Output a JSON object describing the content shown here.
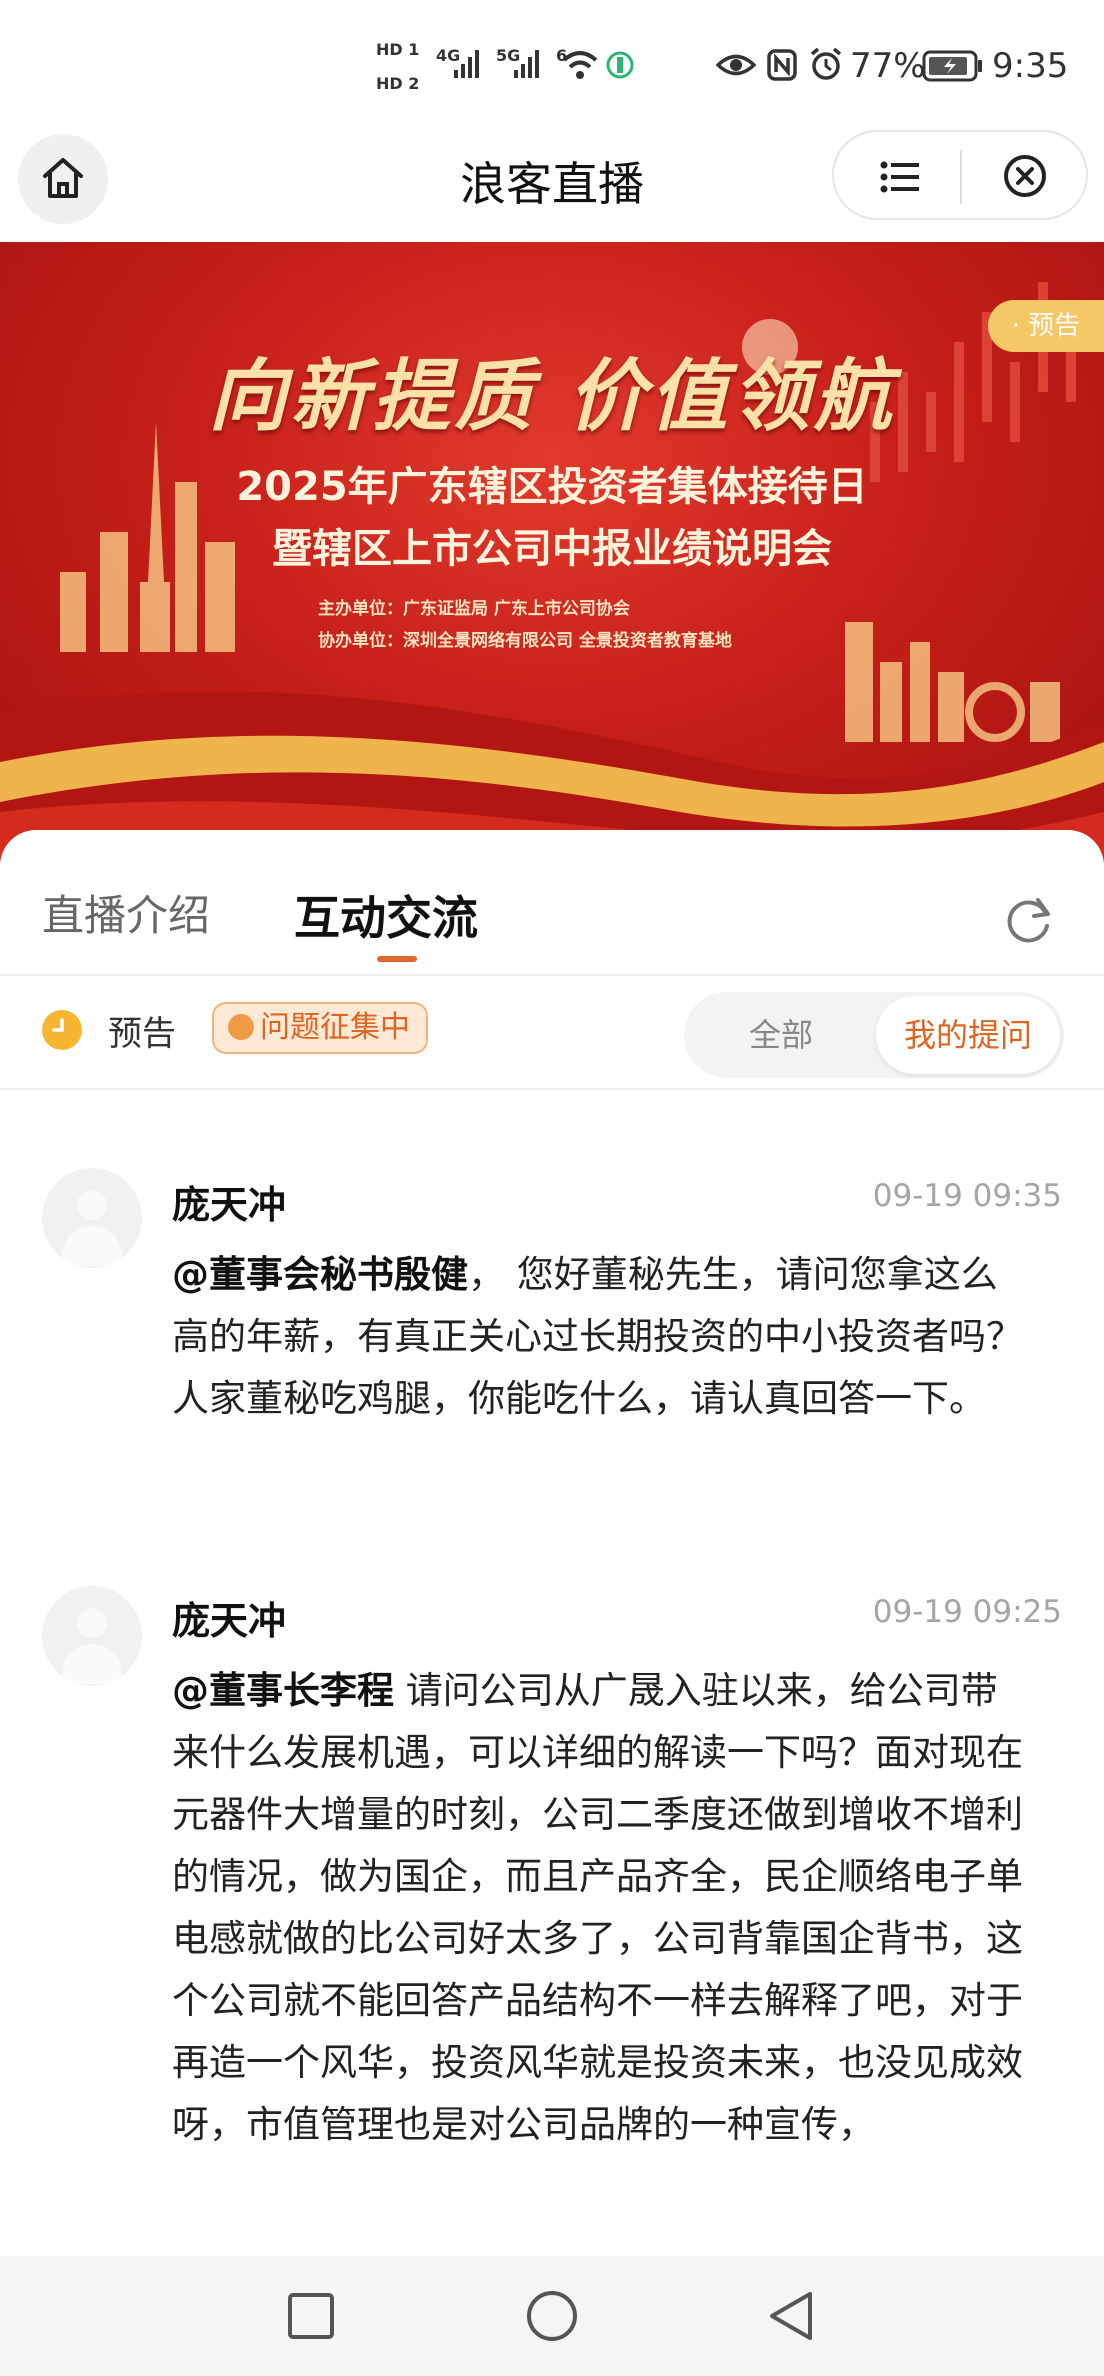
{
  "status_bar": {
    "hd1": "HD 1",
    "hd2": "HD 2",
    "net1": "4G",
    "net2": "5G",
    "wifi_label": "6",
    "battery": "77%",
    "time": "9:35"
  },
  "nav": {
    "title": "浪客直播"
  },
  "banner": {
    "tag": "· 预告",
    "slogan": "向新提质 价值领航",
    "line1": "2025年广东辖区投资者集体接待日",
    "line2": "暨辖区上市公司中报业绩说明会",
    "host": "主办单位：广东证监局  广东上市公司协会",
    "co_host": "协办单位：深圳全景网络有限公司  全景投资者教育基地",
    "colors": {
      "bg": "#c8201a",
      "gold": "#fbe0a8"
    }
  },
  "tabs": [
    {
      "label": "直播介绍",
      "active": false
    },
    {
      "label": "互动交流",
      "active": true
    }
  ],
  "status": {
    "label": "预告",
    "pill": "问题征集中"
  },
  "filter": {
    "all": "全部",
    "mine": "我的提问",
    "selected": "我的提问"
  },
  "comments": [
    {
      "name": "庞天冲",
      "time": "09-19 09:35",
      "mention": "@董事会秘书殷健",
      "text": "，  您好董秘先生，请问您拿这么高的年薪，有真正关心过长期投资的中小投资者吗？人家董秘吃鸡腿，你能吃什么，请认真回答一下。"
    },
    {
      "name": "庞天冲",
      "time": "09-19 09:25",
      "mention": "@董事长李程",
      "text": " 请问公司从广晟入驻以来，给公司带来什么发展机遇，可以详细的解读一下吗？面对现在元器件大增量的时刻，公司二季度还做到增收不增利的情况，做为国企，而且产品齐全，民企顺络电子单电感就做的比公司好太多了，公司背靠国企背书，这个公司就不能回答产品结构不一样去解释了吧，对于再造一个风华，投资风华就是投资未来，也没见成效呀，市值管理也是对公司品牌的一种宣传，"
    }
  ],
  "accent_color": "#e1641e"
}
